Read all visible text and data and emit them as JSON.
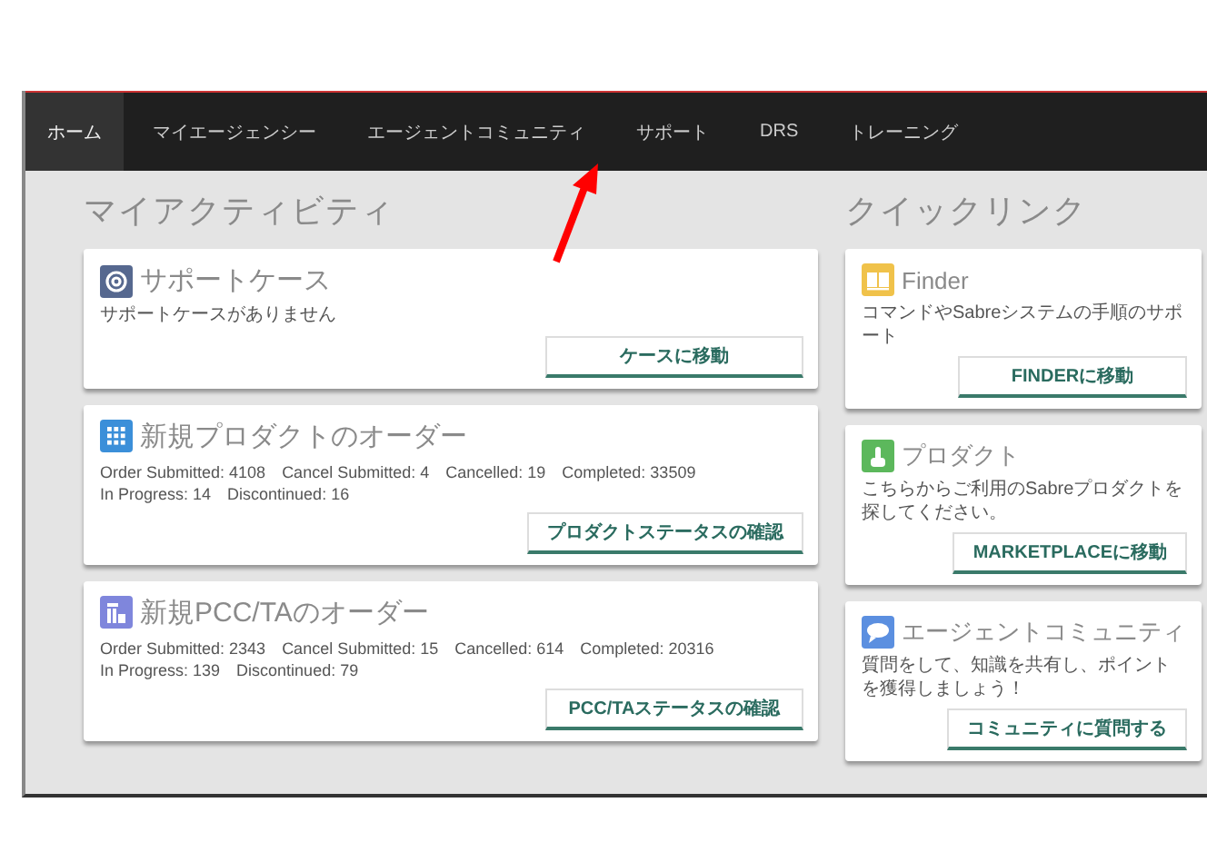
{
  "nav": [
    {
      "label": "ホーム",
      "selected": true
    },
    {
      "label": "マイエージェンシー",
      "selected": false
    },
    {
      "label": "エージェントコミュニティ",
      "selected": false
    },
    {
      "label": "サポート",
      "selected": false
    },
    {
      "label": "DRS",
      "selected": false
    },
    {
      "label": "トレーニング",
      "selected": false
    }
  ],
  "activity": {
    "title": "マイアクティビティ",
    "cards": [
      {
        "title": "サポートケース",
        "color": "#56688f",
        "text": "サポートケースがありません",
        "button": "ケースに移動"
      },
      {
        "title": "新規プロダクトのオーダー",
        "color": "#3b8fd9",
        "stats": [
          "Order Submitted: 4108",
          "Cancel Submitted: 4",
          "Cancelled: 19",
          "Completed: 33509",
          "In Progress: 14",
          "Discontinued: 16"
        ],
        "button": "プロダクトステータスの確認"
      },
      {
        "title": "新規PCC/TAのオーダー",
        "color": "#7f86dc",
        "stats": [
          "Order Submitted: 2343",
          "Cancel Submitted: 15",
          "Cancelled: 614",
          "Completed: 20316",
          "In Progress: 139",
          "Discontinued: 79"
        ],
        "button": "PCC/TAステータスの確認"
      }
    ]
  },
  "quicklinks": {
    "title": "クイックリンク",
    "cards": [
      {
        "title": "Finder",
        "color": "#f0c24a",
        "text": "コマンドやSabreシステムの手順のサポート",
        "button": "FINDERに移動"
      },
      {
        "title": "プロダクト",
        "color": "#5cb85c",
        "text": "こちらからご利用のSabreプロダクトを探してください。",
        "button": "MARKETPLACEに移動"
      },
      {
        "title": "エージェントコミュニティ",
        "color": "#5b8fe0",
        "text": "質問をして、知識を共有し、ポイントを獲得しましょう！",
        "button": "コミュニティに質問する"
      }
    ]
  }
}
